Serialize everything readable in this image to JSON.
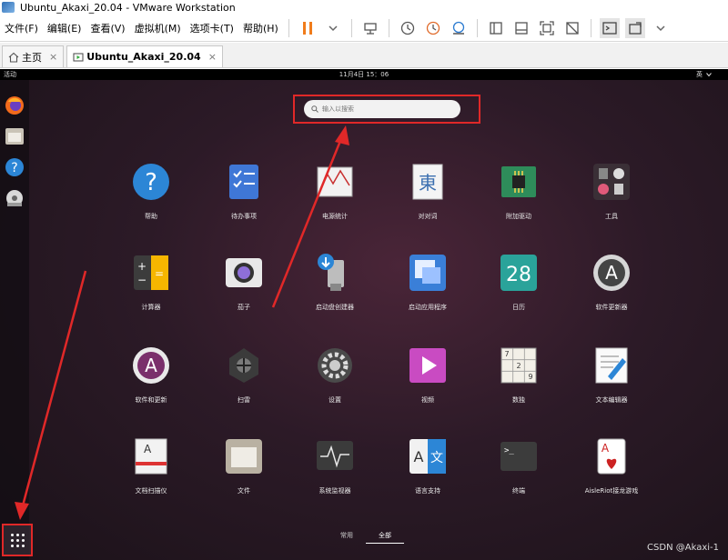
{
  "window": {
    "title": "Ubuntu_Akaxi_20.04 - VMware Workstation"
  },
  "menu": [
    "文件(F)",
    "编辑(E)",
    "查看(V)",
    "虚拟机(M)",
    "选项卡(T)",
    "帮助(H)"
  ],
  "tabs": [
    {
      "label": "主页",
      "close": "×"
    },
    {
      "label": "Ubuntu_Akaxi_20.04",
      "close": "×"
    }
  ],
  "topbar": {
    "activities": "活动",
    "clock": "11月4日 15：06",
    "sys": "英"
  },
  "search": {
    "placeholder": "输入以搜索"
  },
  "apps": [
    {
      "label": "帮助",
      "icon": "help-icon"
    },
    {
      "label": "待办事项",
      "icon": "todo-icon"
    },
    {
      "label": "电源统计",
      "icon": "power-stats-icon"
    },
    {
      "label": "对对词",
      "icon": "dictionary-icon",
      "glyph": "東"
    },
    {
      "label": "附加驱动",
      "icon": "chip-icon"
    },
    {
      "label": "工具",
      "icon": "tools-folder-icon"
    },
    {
      "label": "计算器",
      "icon": "calculator-icon"
    },
    {
      "label": "茄子",
      "icon": "camera-icon"
    },
    {
      "label": "启动盘创建器",
      "icon": "usb-creator-icon"
    },
    {
      "label": "启动应用程序",
      "icon": "startup-apps-icon"
    },
    {
      "label": "日历",
      "icon": "calendar-icon",
      "glyph": "28"
    },
    {
      "label": "软件更新器",
      "icon": "software-updater-icon"
    },
    {
      "label": "软件和更新",
      "icon": "software-updates-icon"
    },
    {
      "label": "扫雷",
      "icon": "mines-icon"
    },
    {
      "label": "设置",
      "icon": "settings-gear-icon"
    },
    {
      "label": "视频",
      "icon": "video-icon"
    },
    {
      "label": "数独",
      "icon": "sudoku-icon"
    },
    {
      "label": "文本编辑器",
      "icon": "text-editor-icon"
    },
    {
      "label": "文档扫描仪",
      "icon": "scanner-icon"
    },
    {
      "label": "文件",
      "icon": "files-icon"
    },
    {
      "label": "系统监视器",
      "icon": "system-monitor-icon"
    },
    {
      "label": "语言支持",
      "icon": "language-icon",
      "glyph": "A 文"
    },
    {
      "label": "终端",
      "icon": "terminal-icon",
      "glyph": ">_"
    },
    {
      "label": "AisleRiot接龙游戏",
      "icon": "cards-icon",
      "glyph": "A"
    }
  ],
  "footer": {
    "frequent": "常用",
    "all": "全部"
  },
  "watermark": "CSDN @Akaxi-1",
  "colors": {
    "accent_red": "#e02828",
    "guest_bg": "#2c1a27"
  }
}
